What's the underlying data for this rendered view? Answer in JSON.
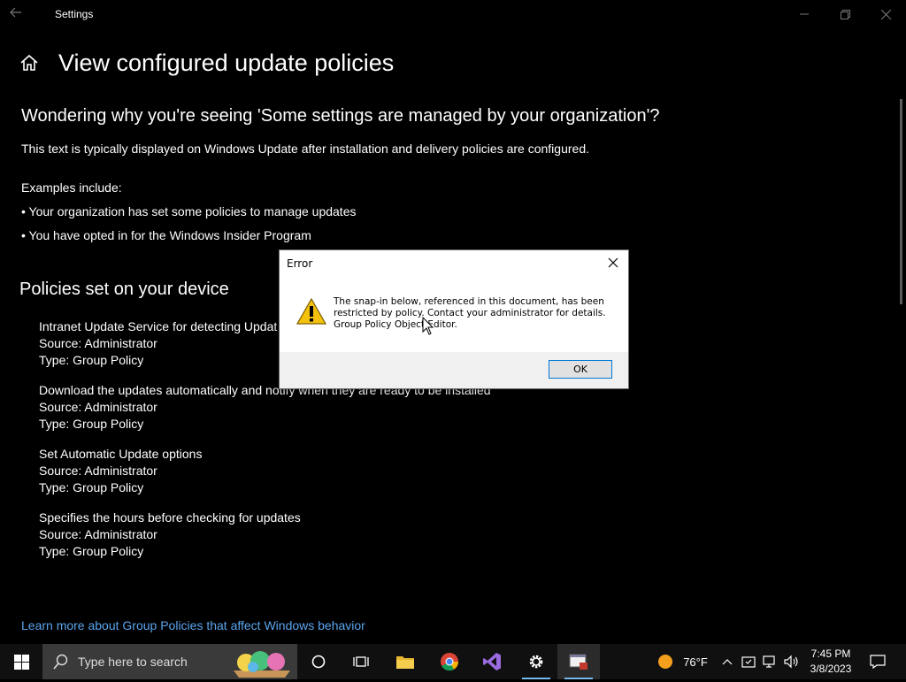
{
  "window": {
    "title": "Settings"
  },
  "header": {
    "page_title": "View configured update policies"
  },
  "intro": {
    "heading": "Wondering why you're seeing 'Some settings are managed by your organization'?",
    "description": "This text is typically displayed on Windows Update after installation and delivery policies are configured.",
    "examples_label": "Examples include:",
    "examples": [
      "• Your organization has set some policies to manage updates",
      "• You have opted in for the Windows Insider Program"
    ]
  },
  "policies": {
    "heading": "Policies set on your device",
    "items": [
      {
        "name": "Intranet Update Service for detecting Updat",
        "source": "Source: Administrator",
        "type": "Type: Group Policy"
      },
      {
        "name": "Download the updates automatically and notify when they are ready to be installed",
        "source": "Source: Administrator",
        "type": "Type: Group Policy"
      },
      {
        "name": "Set Automatic Update options",
        "source": "Source: Administrator",
        "type": "Type: Group Policy"
      },
      {
        "name": "Specifies the hours before checking for updates",
        "source": "Source: Administrator",
        "type": "Type: Group Policy"
      }
    ],
    "learn_more_link": "Learn more about Group Policies that affect Windows behavior"
  },
  "dialog": {
    "title": "Error",
    "message_lines": [
      "The snap-in below, referenced in this document, has been",
      "restricted by policy. Contact your administrator for details.",
      "Group Policy Object Editor."
    ],
    "ok_label": "OK",
    "icon": "warning-icon"
  },
  "taskbar": {
    "search_placeholder": "Type here to search",
    "weather_temp": "76°F",
    "time": "7:45 PM",
    "date": "3/8/2023",
    "icons": [
      "windows-start-icon",
      "search-icon",
      "cortana-icon",
      "task-view-icon",
      "file-explorer-icon",
      "chrome-icon",
      "visual-studio-icon",
      "settings-icon",
      "gpedit-icon"
    ]
  },
  "colors": {
    "accent_link": "#5aa5ee",
    "background": "#000000",
    "taskbar": "#101010"
  }
}
